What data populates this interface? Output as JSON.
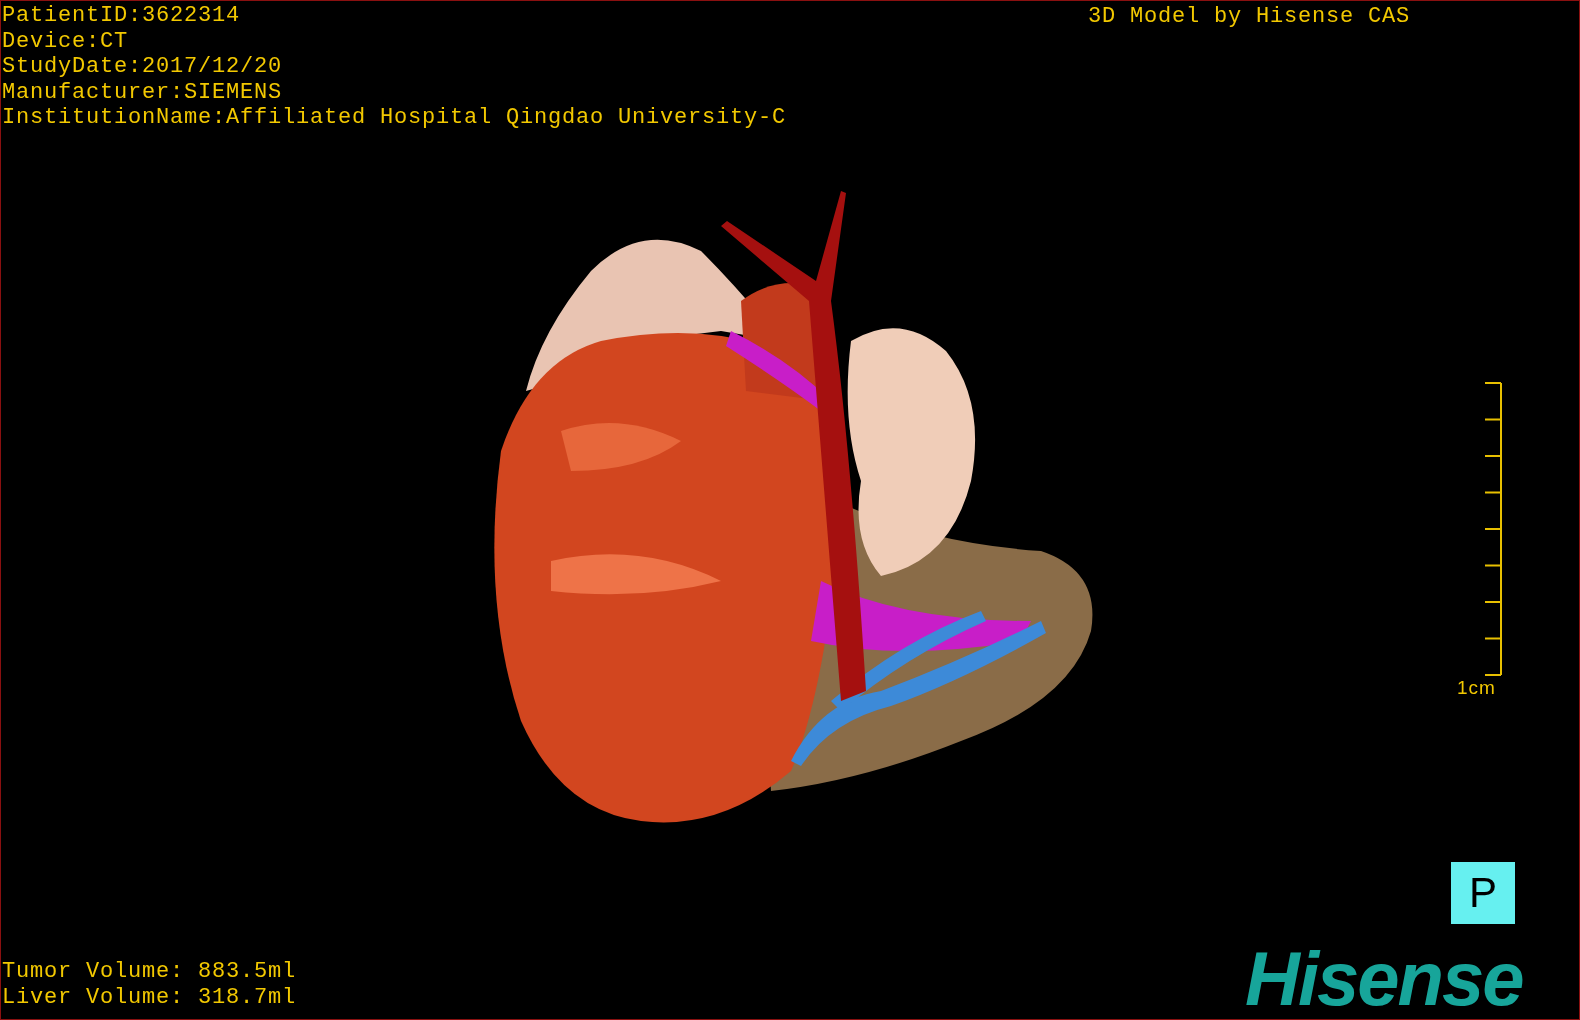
{
  "study_info": [
    "PatientID:3622314",
    "Device:CT",
    "StudyDate:2017/12/20",
    "Manufacturer:SIEMENS",
    "InstitutionName:Affiliated Hospital Qingdao University-C"
  ],
  "credit": "3D Model by Hisense CAS",
  "scale_label": "1cm",
  "orientation_label": "P",
  "volumes": [
    "Tumor Volume: 883.5ml",
    "Liver Volume: 318.7ml"
  ],
  "logo": "Hisense"
}
